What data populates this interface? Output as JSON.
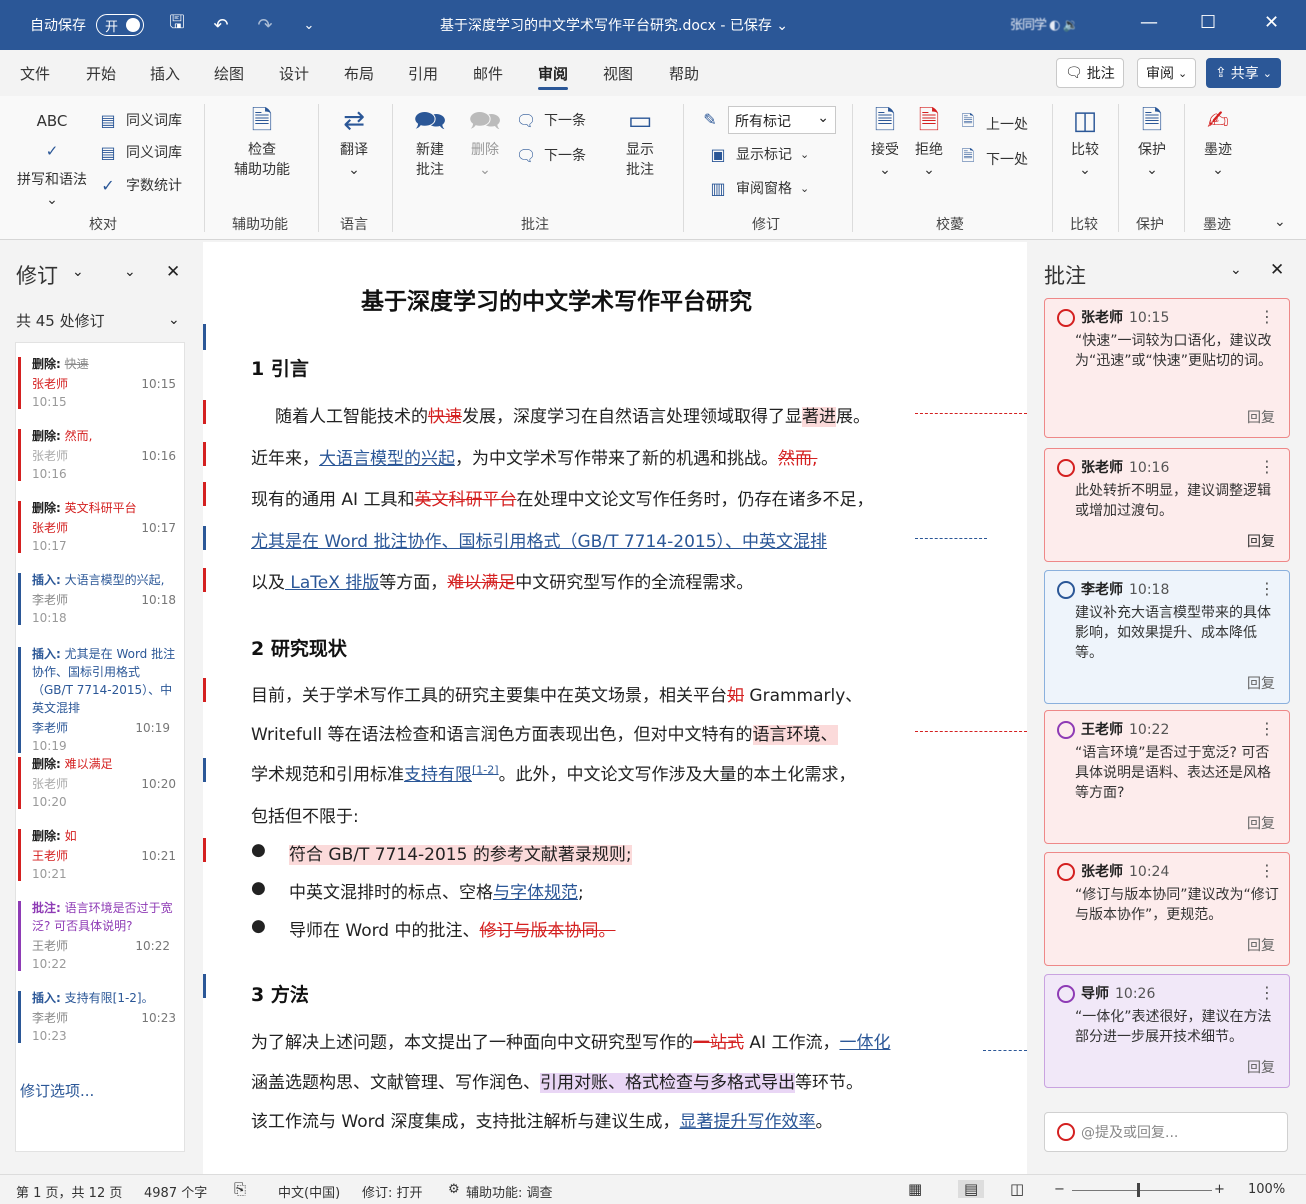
{
  "titlebar": {
    "autosave_label": "自动保存",
    "autosave_state": "开",
    "doc_title": "基于深度学习的中文学术写作平台研究.docx  -  已保存  ⌄",
    "user_name": "张同学 ◐ 🔉"
  },
  "tabs": [
    "文件",
    "开始",
    "插入",
    "绘图",
    "设计",
    "布局",
    "引用",
    "邮件",
    "审阅",
    "视图",
    "帮助"
  ],
  "top_buttons": {
    "comments": "批注",
    "review": "审阅",
    "share": "共享"
  },
  "ribbon": {
    "spell": "拼写和语法",
    "thesaurus1": "同义词库",
    "thesaurus2": "同义词库",
    "wordcount": "字数统计",
    "check_a11y": "检查\n辅助功能",
    "translate": "翻译",
    "new_comment": "新建\n批注",
    "delete": "删除",
    "next": "下一条",
    "prev": "下一条",
    "show_comments": "显示\n批注",
    "all_markup": "所有标记",
    "show_markup": "显示标记",
    "review_pane": "审阅窗格",
    "accept": "接受",
    "reject": "拒绝",
    "prev_change": "上一处",
    "next_change": "下一处",
    "compare": "比较",
    "protect": "保护",
    "ink": "墨迹",
    "groups": [
      "校对",
      "辅助功能",
      "语言",
      "批注",
      "修订",
      "校薆",
      "比较",
      "保护",
      "墨迹"
    ]
  },
  "revisions": {
    "title": "修订",
    "count": "共 45 处修订",
    "options": "修订选项...",
    "items": [
      {
        "type": "删除:",
        "text": "快速",
        "author": "张老师",
        "time": "10:15",
        "date": "10:15",
        "color": "#d42020"
      },
      {
        "type": "删除:",
        "text": "然而,",
        "author": "张老师",
        "time": "10:16",
        "date": "10:16",
        "color": "#d42020"
      },
      {
        "type": "删除:",
        "text": "英文科研平台",
        "author": "张老师",
        "time": "10:17",
        "date": "10:17",
        "color": "#d42020"
      },
      {
        "type": "插入:",
        "text": "大语言模型的兴起,",
        "author": "李老师",
        "time": "10:18",
        "date": "10:18",
        "color": "#2b5797"
      },
      {
        "type": "插入:",
        "text": "尤其是在 Word 批注协作、国标引用格式（GB/T 7714-2015）、中英文混排",
        "author": "李老师",
        "time": "10:19",
        "date": "10:19",
        "color": "#2b5797"
      },
      {
        "type": "删除:",
        "text": "难以满足",
        "author": "张老师",
        "time": "10:20",
        "date": "10:20",
        "color": "#d42020"
      },
      {
        "type": "删除:",
        "text": "如",
        "author": "王老师",
        "time": "10:21",
        "date": "10:21",
        "color": "#d42020"
      },
      {
        "type": "批注:",
        "text": "语言环境是否过于宽泛? 可否具体说明?",
        "author": "王老师",
        "time": "10:22",
        "date": "10:22",
        "color": "#8e3bb5"
      },
      {
        "type": "插入:",
        "text": "支持有限[1-2]。",
        "author": "李老师",
        "time": "10:23",
        "date": "10:23",
        "color": "#2b5797"
      }
    ]
  },
  "document": {
    "title": "基于深度学习的中文学术写作平台研究",
    "s1": "1    引言",
    "s2": "2    研究现状",
    "s3": "3    方法",
    "p1_a": "随着人工智能技术的",
    "p1_del": "快速",
    "p1_b": "发展，深度学习在自然语言处理领域取得了显",
    "p1_hl": "著进",
    "p1_c": "展。",
    "p2_a": "近年来，",
    "p2_ins": "大语言模型的兴起",
    "p2_b": "，为中文学术写作带来了新的机遇和挑战。",
    "p2_del": "然而,",
    "p3_a": "现有的通用 AI 工具和",
    "p3_del": "英文科研平台",
    "p3_b": "在处理中文论文写作任务时，仍存在诸多不足，",
    "p4_ins": "尤其是在 Word 批注协作、国标引用格式（GB/T 7714-2015）、中英文混排",
    "p5_a": "以及",
    "p5_ins": " LaTeX 排版",
    "p5_b": "等方面，",
    "p5_del": "难以满足",
    "p5_c": "中文研究型写作的全流程需求。",
    "p6_a": "目前，关于学术写作工具的研究主要集中在英文场景，相关平台",
    "p6_del": "如",
    "p6_b": " Grammarly、",
    "p7_a": "Writefull 等在语法检查和语言润色方面表现出色，但对中文特有的",
    "p7_hl": "语言环境、",
    "p8_a": "学术规范和引用标准",
    "p8_ins": "支持有限",
    "p8_sup": "[1-2]",
    "p8_b": "。此外，中文论文写作涉及大量的本土化需求，",
    "p9": "包括但不限于:",
    "b1": "符合 GB/T 7714-2015 的参考文献著录规则;",
    "b2_a": "中英文混排时的标点、空格",
    "b2_ins": "与字体规范",
    "b2_b": ";",
    "b3_a": "导师在 Word 中的批注、",
    "b3_del": "修订与版本协同",
    "b3_b": "。",
    "p10_a": "为了解决上述问题，本文提出了一种面向中文研究型写作的",
    "p10_del": "一站式",
    "p10_b": " AI 工作流，",
    "p10_ins": "一体化",
    "p11_a": "涵盖选题构思、文献管理、写作润色、",
    "p11_hl": "引用对账、格式检查与多格式导出",
    "p11_b": "等环节。",
    "p12_a": "该工作流与 Word 深度集成，支持批注解析与建议生成，",
    "p12_ins": "显著提升写作效率",
    "p12_b": "。"
  },
  "comments": {
    "title": "批注",
    "reply_label": "回复",
    "mention_placeholder": "@提及或回复...",
    "items": [
      {
        "author": "张老师",
        "time": "10:15",
        "text": "“快速”一词较为口语化，建议改为“迅速”或“快速”更贴切的词。",
        "color": "#d42020",
        "bg": "#fdecec"
      },
      {
        "author": "张老师",
        "time": "10:16",
        "text": "此处转折不明显，建议调整逻辑或增加过渡句。",
        "color": "#d42020",
        "bg": "#fdecec"
      },
      {
        "author": "李老师",
        "time": "10:18",
        "text": "建议补充大语言模型带来的具体影响，如效果提升、成本降低等。",
        "color": "#2b5797",
        "bg": "#eef4fb"
      },
      {
        "author": "王老师",
        "time": "10:22",
        "text": "“语言环境”是否过于宽泛? 可否具体说明是语料、表达还是风格等方面?",
        "color": "#8e3bb5",
        "bg": "#fdecec"
      },
      {
        "author": "张老师",
        "time": "10:24",
        "text": "“修订与版本协同”建议改为“修订与版本协作”，更规范。",
        "color": "#d42020",
        "bg": "#fdecec"
      },
      {
        "author": "导师",
        "time": "10:26",
        "text": "“一体化”表述很好，建议在方法部分进一步展开技术细节。",
        "color": "#8e3bb5",
        "bg": "#f1e8f8"
      }
    ]
  },
  "statusbar": {
    "page": "第 1 页，共 12 页",
    "words": "4987 个字",
    "lang": "中文(中国)",
    "track": "修订: 打开",
    "a11y": "辅助功能: 调查",
    "zoom": "100%"
  }
}
